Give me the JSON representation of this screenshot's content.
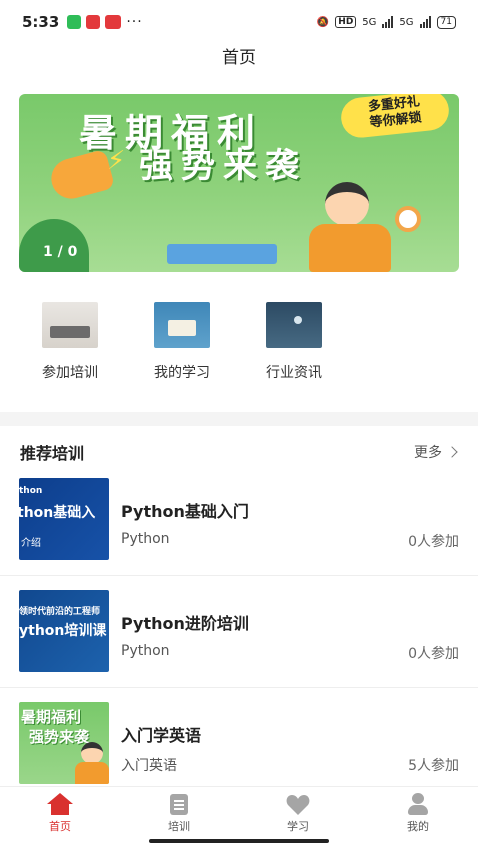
{
  "status_bar": {
    "time": "5:33",
    "network_1": "5G",
    "network_2": "5G",
    "hd": "HD",
    "battery": "71"
  },
  "header": {
    "title": "首页"
  },
  "banner": {
    "title_line1": "暑期福利",
    "title_line2": "强势来袭",
    "badge_line1": "多重好礼",
    "badge_line2": "等你解锁",
    "counter": "1 / 0"
  },
  "quick_nav": [
    {
      "label": "参加培训",
      "icon": "training-thumbnail"
    },
    {
      "label": "我的学习",
      "icon": "study-thumbnail"
    },
    {
      "label": "行业资讯",
      "icon": "news-thumbnail"
    }
  ],
  "recommended": {
    "title": "推荐培训",
    "more_label": "更多",
    "courses": [
      {
        "title": "Python基础入门",
        "category": "Python",
        "count": "0人参加",
        "thumb_lines": [
          "thon",
          "thon基础入",
          "介绍"
        ]
      },
      {
        "title": "Python进阶培训",
        "category": "Python",
        "count": "0人参加",
        "thumb_lines": [
          "领时代前沿的工程师",
          "ython培训课"
        ]
      },
      {
        "title": "入门学英语",
        "category": "入门英语",
        "count": "5人参加",
        "thumb_lines": [
          "暑期福利",
          "强势来袭"
        ]
      }
    ]
  },
  "bottom_nav": [
    {
      "label": "首页",
      "icon": "home-icon",
      "active": true
    },
    {
      "label": "培训",
      "icon": "document-icon",
      "active": false
    },
    {
      "label": "学习",
      "icon": "heart-icon",
      "active": false
    },
    {
      "label": "我的",
      "icon": "user-icon",
      "active": false
    }
  ],
  "colors": {
    "accent": "#d9312f",
    "banner_green": "#79c96a",
    "inactive_icon": "#a5a5a5"
  }
}
